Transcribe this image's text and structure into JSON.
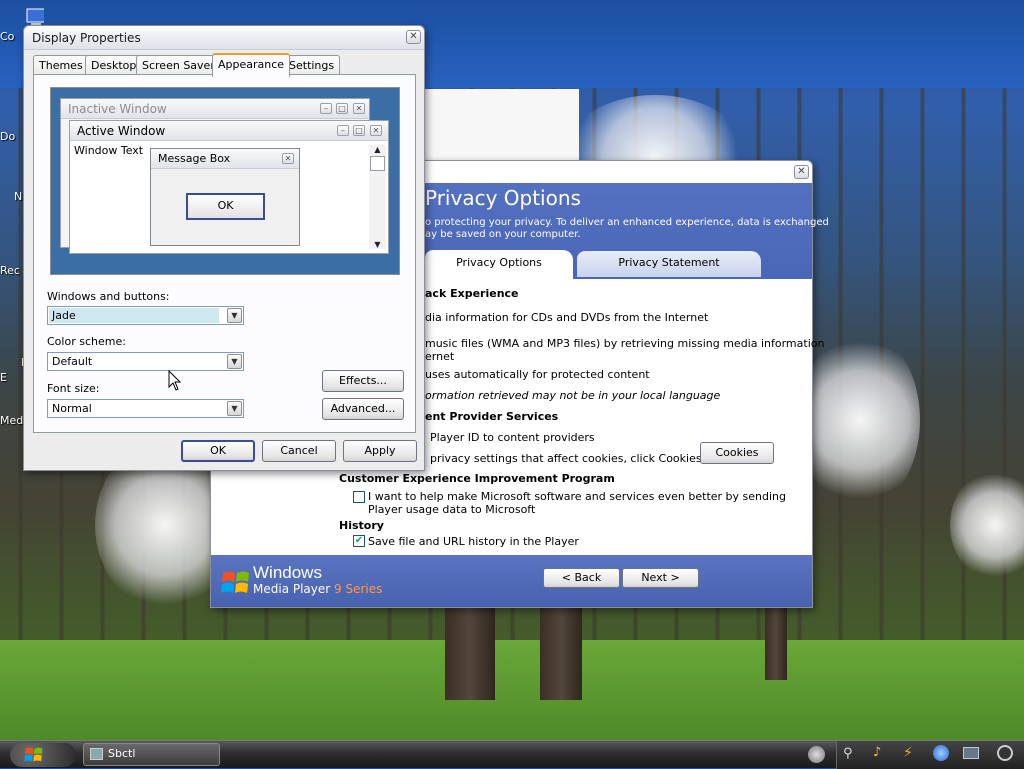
{
  "desktop": {
    "icons": [
      {
        "label": "Co",
        "icon": "my-computer-icon"
      },
      {
        "label": "Do",
        "icon": "my-documents-icon"
      },
      {
        "label": "N",
        "icon": "network-icon"
      },
      {
        "label": "Rec",
        "icon": "recycle-bin-icon"
      },
      {
        "label": "In\nE",
        "icon": "internet-explorer-icon"
      },
      {
        "label": "Med",
        "icon": "media-icon"
      }
    ]
  },
  "display_properties": {
    "title": "Display Properties",
    "tabs": [
      "Themes",
      "Desktop",
      "Screen Saver",
      "Appearance",
      "Settings"
    ],
    "active_tab": "Appearance",
    "preview": {
      "inactive_title": "Inactive Window",
      "active_title": "Active Window",
      "window_text": "Window Text",
      "message_box_title": "Message Box",
      "message_box_ok": "OK"
    },
    "windows_buttons_label": "Windows and buttons:",
    "windows_buttons_value": "Jade",
    "color_scheme_label": "Color scheme:",
    "color_scheme_value": "Default",
    "font_size_label": "Font size:",
    "font_size_value": "Normal",
    "effects_button": "Effects...",
    "advanced_button": "Advanced...",
    "ok_button": "OK",
    "cancel_button": "Cancel",
    "apply_button": "Apply"
  },
  "wmp_wizard": {
    "heading": "Privacy Options",
    "intro_line1": "o protecting your privacy.  To deliver an enhanced experience, data is exchanged",
    "intro_line2": "ay be saved on your computer.",
    "tabs": [
      "Privacy Options",
      "Privacy Statement"
    ],
    "active_tab": "Privacy Options",
    "section_playback": "ack Experience",
    "item_media_info": "dia information for CDs and DVDs from the Internet",
    "item_music_files_line1": "music files (WMA and MP3 files) by retrieving missing media information",
    "item_music_files_line2": "ernet",
    "item_licenses": "uses automatically for protected content",
    "note_language": "ormation retrieved may not be in your local language",
    "section_content_provider": "ent Provider Services",
    "item_player_id": "Player ID to content providers",
    "item_cookies_text": "privacy settings that affect cookies, click Cookies",
    "cookies_button": "Cookies",
    "section_ceip": "Customer Experience Improvement Program",
    "ceip_line1": "I want to help make Microsoft software and services even better by sending",
    "ceip_line2": "Player usage data to Microsoft",
    "ceip_checked": false,
    "section_history": "History",
    "history_text": "Save file and URL history in the Player",
    "history_checked": true,
    "logo_windows": "Windows",
    "logo_media_player": "Media Player",
    "logo_series": "9 Series",
    "back_button": "< Back",
    "next_button": "Next >"
  },
  "taskbar": {
    "task_label": "Sbctl"
  },
  "colors": {
    "wmp_blue": "#4b67b8",
    "series_orange": "#ff9a3c",
    "preview_backdrop": "#3a6ea5",
    "jade_selected": "#cde8f0"
  }
}
